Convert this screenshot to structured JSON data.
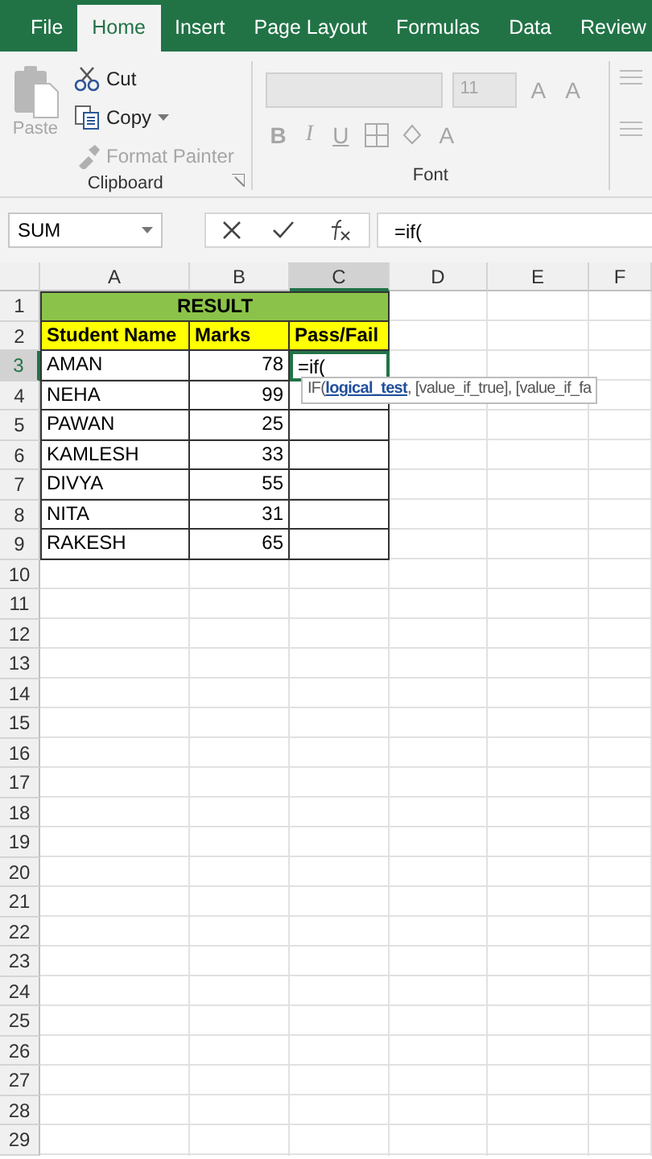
{
  "tabs": [
    {
      "label": "File",
      "selected": false
    },
    {
      "label": "Home",
      "selected": true
    },
    {
      "label": "Insert",
      "selected": false
    },
    {
      "label": "Page Layout",
      "selected": false
    },
    {
      "label": "Formulas",
      "selected": false
    },
    {
      "label": "Data",
      "selected": false
    },
    {
      "label": "Review",
      "selected": false
    }
  ],
  "clipboard": {
    "paste": {
      "label": "Paste",
      "disabled": true
    },
    "items": [
      {
        "kind": "cut",
        "label": "Cut",
        "disabled": false
      },
      {
        "kind": "copy",
        "label": "Copy",
        "disabled": false
      },
      {
        "kind": "painter",
        "label": "Format Painter",
        "disabled": true
      }
    ],
    "label": "Clipboard"
  },
  "font": {
    "size": "11",
    "bold": "B",
    "italic": "I",
    "underline": "U",
    "grow": "A",
    "shrink": "A",
    "font_color": "A",
    "disabled": true,
    "label": "Font"
  },
  "formula_bar": {
    "name_box": "SUM",
    "value": "=if("
  },
  "columns": [
    {
      "label": "A",
      "selected": false
    },
    {
      "label": "B",
      "selected": false
    },
    {
      "label": "C",
      "selected": true
    },
    {
      "label": "D",
      "selected": false
    },
    {
      "label": "E",
      "selected": false
    },
    {
      "label": "F",
      "selected": false
    }
  ],
  "rows": [
    {
      "label": "1",
      "selected": false,
      "kind": "title",
      "cells": [
        "RESULT"
      ]
    },
    {
      "label": "2",
      "selected": false,
      "kind": "header",
      "cells": [
        "Student Name",
        "Marks",
        "Pass/Fail"
      ]
    },
    {
      "label": "3",
      "selected": true,
      "kind": "data",
      "cells": [
        "AMAN",
        "78",
        "=if("
      ]
    },
    {
      "label": "4",
      "selected": false,
      "kind": "data",
      "cells": [
        "NEHA",
        "99"
      ]
    },
    {
      "label": "5",
      "selected": false,
      "kind": "data",
      "cells": [
        "PAWAN",
        "25"
      ]
    },
    {
      "label": "6",
      "selected": false,
      "kind": "data",
      "cells": [
        "KAMLESH",
        "33"
      ]
    },
    {
      "label": "7",
      "selected": false,
      "kind": "data",
      "cells": [
        "DIVYA",
        "55"
      ]
    },
    {
      "label": "8",
      "selected": false,
      "kind": "data",
      "cells": [
        "NITA",
        "31"
      ]
    },
    {
      "label": "9",
      "selected": false,
      "kind": "data",
      "cells": [
        "RAKESH",
        "65"
      ]
    },
    {
      "label": "10",
      "selected": false
    },
    {
      "label": "11",
      "selected": false
    },
    {
      "label": "12",
      "selected": false
    },
    {
      "label": "13",
      "selected": false
    },
    {
      "label": "14",
      "selected": false
    },
    {
      "label": "15",
      "selected": false
    },
    {
      "label": "16",
      "selected": false
    },
    {
      "label": "17",
      "selected": false
    },
    {
      "label": "18",
      "selected": false
    },
    {
      "label": "19",
      "selected": false
    },
    {
      "label": "20",
      "selected": false
    },
    {
      "label": "21",
      "selected": false
    },
    {
      "label": "22",
      "selected": false
    },
    {
      "label": "23",
      "selected": false
    },
    {
      "label": "24",
      "selected": false
    },
    {
      "label": "25",
      "selected": false
    },
    {
      "label": "26",
      "selected": false
    },
    {
      "label": "27",
      "selected": false
    },
    {
      "label": "28",
      "selected": false
    },
    {
      "label": "29",
      "selected": false
    }
  ],
  "tooltip": {
    "function": "IF(",
    "argument": "logical_test",
    "rest": ", [value_if_true], [value_if_fa"
  }
}
